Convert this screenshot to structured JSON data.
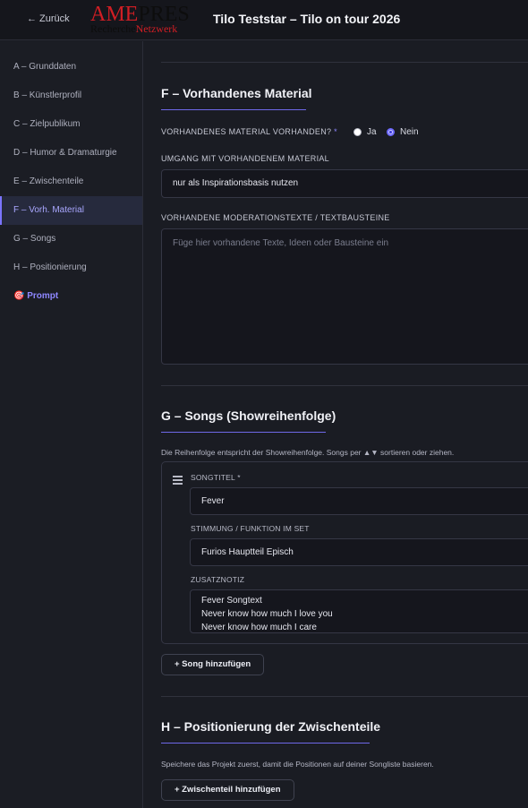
{
  "header": {
    "back_label": "← Zurück",
    "logo": {
      "line1_red": "AME",
      "line1_dark": "PRES",
      "line2_dark": "Recherche",
      "line2_red": "Netzwerk"
    },
    "title": "Tilo Teststar – Tilo on tour 2026"
  },
  "sidebar": {
    "items": [
      {
        "label": "A – Grunddaten"
      },
      {
        "label": "B – Künstlerprofil"
      },
      {
        "label": "C – Zielpublikum"
      },
      {
        "label": "D – Humor & Dramaturgie"
      },
      {
        "label": "E – Zwischenteile"
      },
      {
        "label": "F – Vorh. Material"
      },
      {
        "label": "G – Songs"
      },
      {
        "label": "H – Positionierung"
      },
      {
        "label": "🎯 Prompt"
      }
    ],
    "active_index": 5
  },
  "section_f": {
    "title": "F – Vorhandenes Material",
    "material_label": "VORHANDENES MATERIAL VORHANDEN?",
    "required_mark": "*",
    "option_yes": "Ja",
    "option_no": "Nein",
    "selected": "Nein",
    "umgang_label": "UMGANG MIT VORHANDENEM MATERIAL",
    "umgang_value": "nur als Inspirationsbasis nutzen",
    "texte_label": "VORHANDENE MODERATIONSTEXTE / TEXTBAUSTEINE",
    "texte_placeholder": "Füge hier vorhandene Texte, Ideen oder Bausteine ein"
  },
  "section_g": {
    "title": "G – Songs (Showreihenfolge)",
    "hint": "Die Reihenfolge entspricht der Showreihenfolge. Songs per ▲▼ sortieren oder ziehen.",
    "song": {
      "title_label": "SONGTITEL *",
      "title_value": "Fever",
      "mood_label": "STIMMUNG / FUNKTION IM SET",
      "mood_value": "Furios Hauptteil Episch",
      "note_label": "ZUSATZNOTIZ",
      "note_lines": [
        "Fever Songtext",
        "Never know how much I love you",
        "Never know how much I care"
      ]
    },
    "add_button": "+ Song hinzufügen"
  },
  "section_h": {
    "title": "H – Positionierung der Zwischenteile",
    "hint": "Speichere das Projekt zuerst, damit die Positionen auf deiner Songliste basieren.",
    "add_button": "+ Zwischenteil hinzufügen"
  },
  "colors": {
    "accent": "#7b74ff",
    "background": "#1a1c23",
    "brand_red": "#d01e24"
  }
}
